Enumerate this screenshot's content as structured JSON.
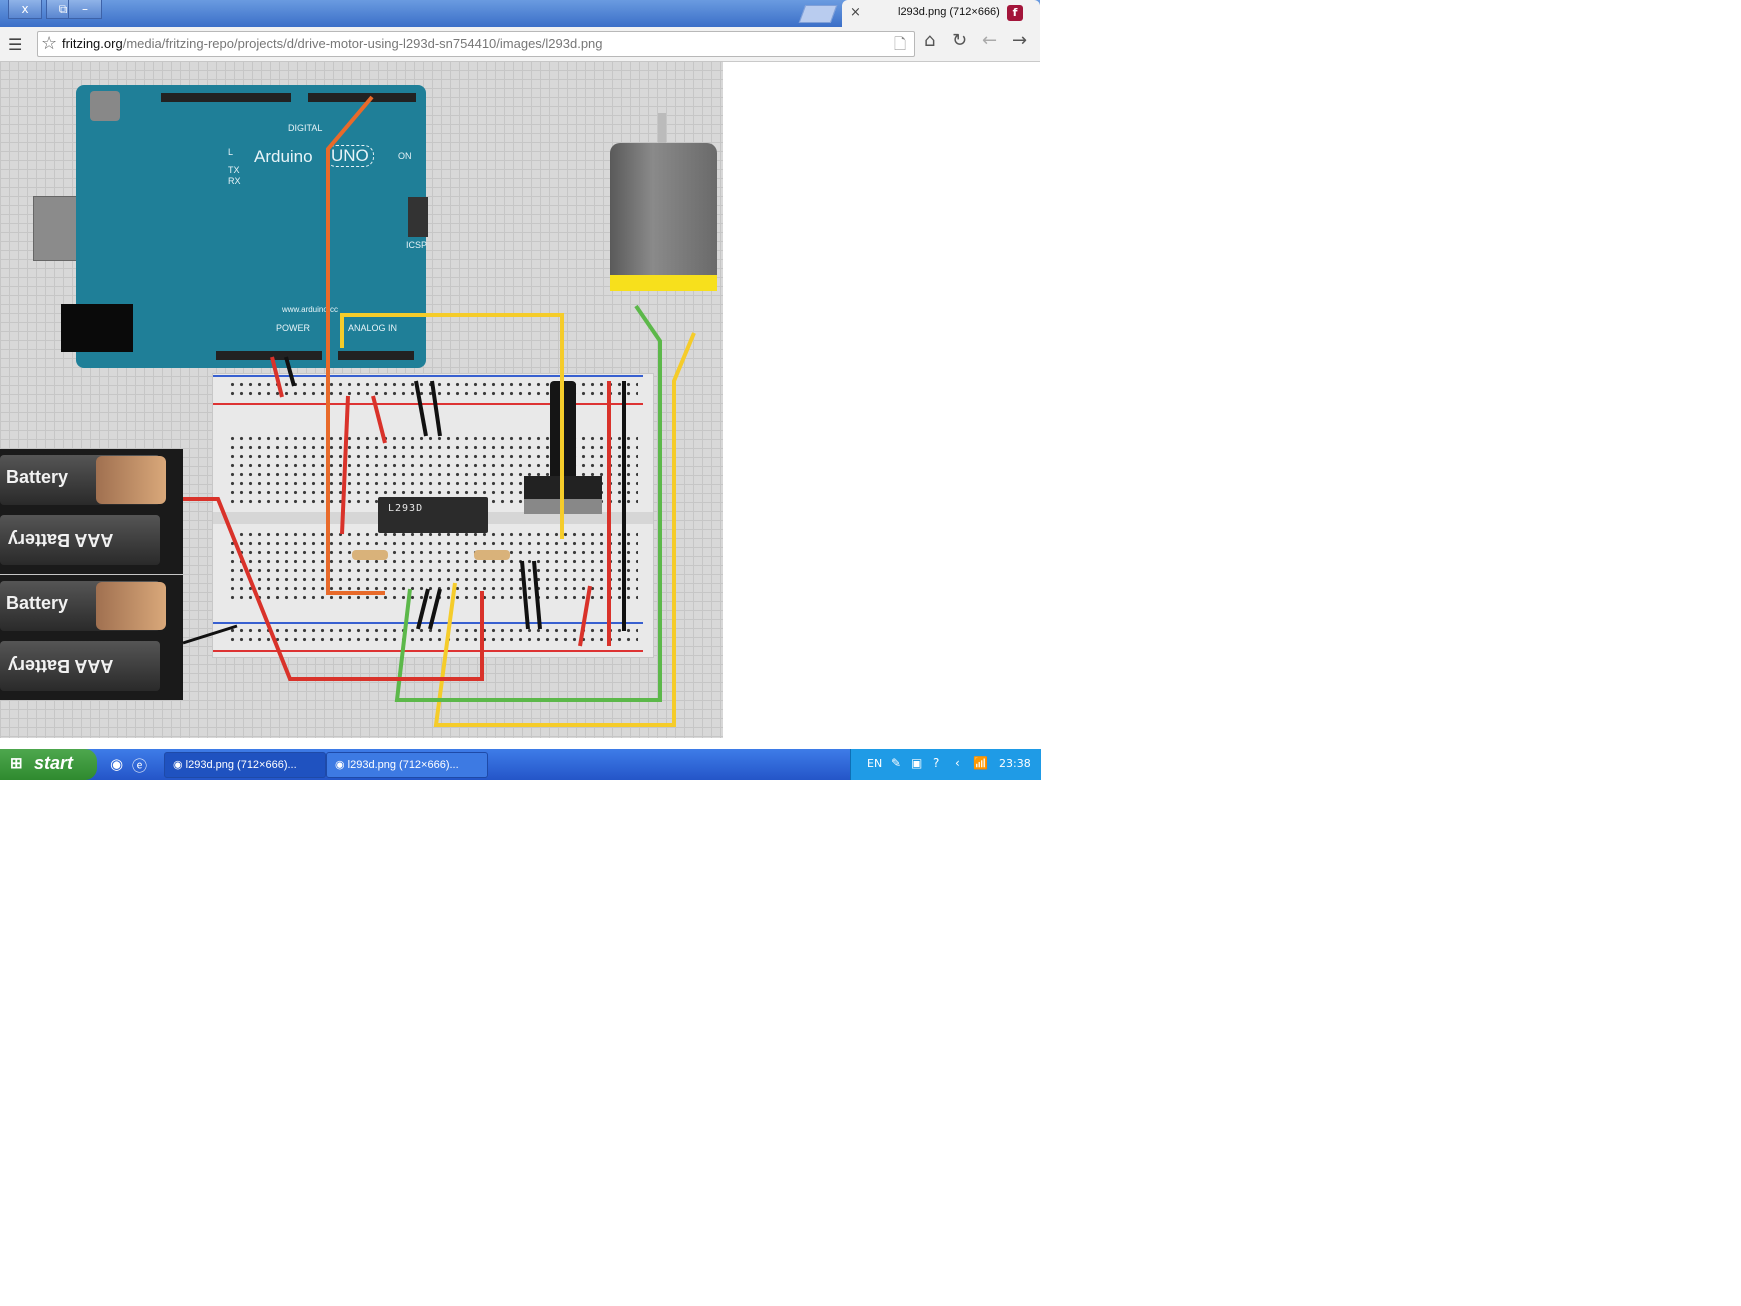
{
  "window": {
    "close_glyph": "x",
    "restore_glyph": "⧉",
    "minimize_glyph": "–"
  },
  "tab": {
    "close_glyph": "×",
    "title": "l293d.png (712×666)"
  },
  "address_bar": {
    "host": "fritzing.org",
    "path": "/media/fritzing-repo/projects/d/drive-motor-using-l293d-sn754410/images/l293d.png"
  },
  "image": {
    "arduino_brand": "Arduino",
    "arduino_model": "UNO",
    "arduino_url": "www.arduino.cc",
    "pin_labels_digital": "DIGITAL",
    "pin_labels_power": "POWER",
    "pin_labels_analog": "ANALOG IN",
    "label_l": "L",
    "label_tx": "TX",
    "label_rx": "RX",
    "label_on": "ON",
    "label_icsp": "ICSP",
    "chip_label": "L293D",
    "battery_labels": [
      "Battery",
      "AAA Battery",
      "Battery",
      "AAA Battery"
    ]
  },
  "taskbar": {
    "start_label": "start",
    "tasks": [
      "l293d.png (712×666)...",
      "l293d.png (712×666)..."
    ],
    "language": "EN",
    "clock": "23:38"
  },
  "colors": {
    "wire_orange": "#e86a2a",
    "wire_yellow": "#f5cc2a",
    "wire_green": "#5cb84a",
    "wire_red": "#d9322a",
    "wire_black": "#111111"
  }
}
